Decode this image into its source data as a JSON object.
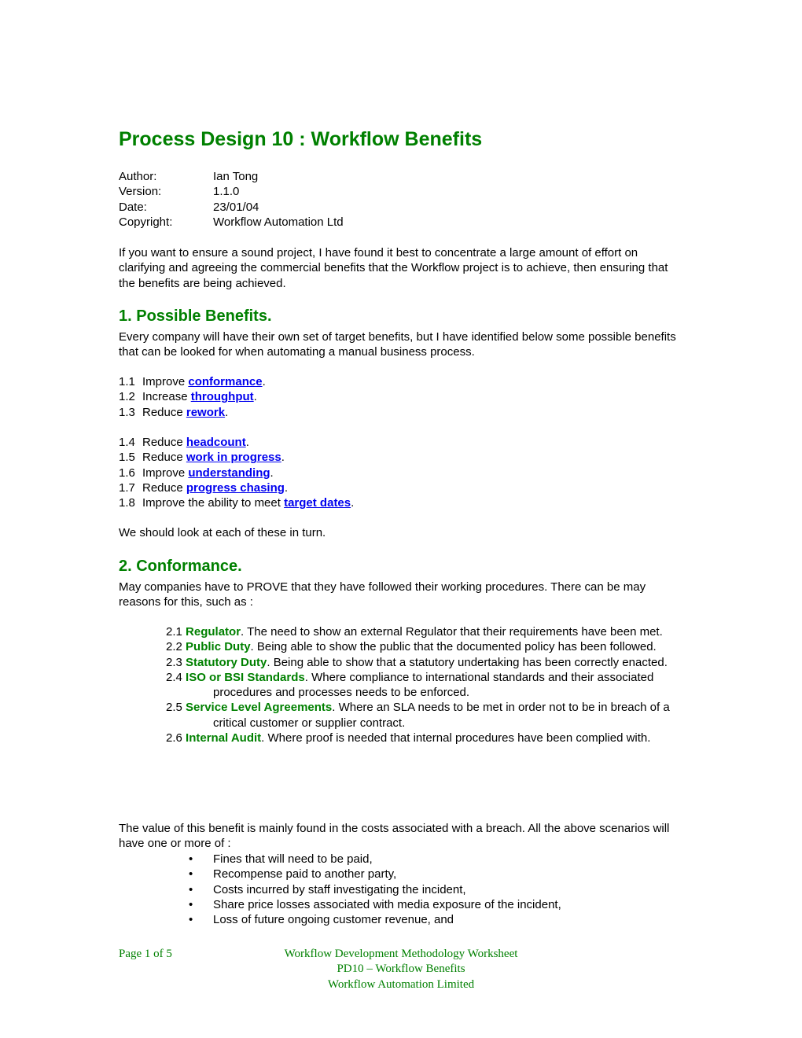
{
  "title": "Process Design 10 : Workflow Benefits",
  "meta": [
    {
      "label": "Author:",
      "value": "Ian Tong"
    },
    {
      "label": "Version:",
      "value": "1.1.0"
    },
    {
      "label": "Date:",
      "value": "23/01/04"
    },
    {
      "label": "Copyright:",
      "value": "Workflow Automation Ltd"
    }
  ],
  "intro": "If you want to ensure a sound project, I have found it best to concentrate a large amount of effort on clarifying and agreeing the commercial benefits that the Workflow project is to achieve, then ensuring that the benefits are being achieved.",
  "section1": {
    "heading": "1. Possible Benefits.",
    "text": "Every company will have their own set of target benefits, but I have identified below some possible benefits that can be looked for when automating a manual business process.",
    "benefits": [
      {
        "num": "1.1",
        "prefix": "Improve ",
        "link": "conformance",
        "suffix": "."
      },
      {
        "num": "1.2",
        "prefix": "Increase ",
        "link": "throughput",
        "suffix": "."
      },
      {
        "num": "1.3",
        "prefix": "Reduce ",
        "link": "rework",
        "suffix": "."
      },
      {
        "num": "1.4",
        "prefix": "Reduce ",
        "link": "headcount",
        "suffix": "."
      },
      {
        "num": "1.5",
        "prefix": "Reduce ",
        "link": "work in progress",
        "suffix": "."
      },
      {
        "num": "1.6",
        "prefix": "Improve ",
        "link": "understanding",
        "suffix": "."
      },
      {
        "num": "1.7",
        "prefix": "Reduce ",
        "link": "progress chasing",
        "suffix": "."
      },
      {
        "num": "1.8",
        "prefix": "Improve the ability to meet ",
        "link": "target dates",
        "suffix": "."
      }
    ],
    "closing": "We should look at each of these in turn."
  },
  "section2": {
    "heading": "2. Conformance.",
    "text": "May companies have to PROVE that they have followed their working procedures. There can be may reasons for this, such as :",
    "reasons": [
      {
        "num": "2.1 ",
        "term": "Regulator",
        "desc": ". The need to show an external Regulator that their requirements have been met."
      },
      {
        "num": "2.2 ",
        "term": "Public Duty",
        "desc": ". Being able to show the public that the documented policy has been followed."
      },
      {
        "num": "2.3 ",
        "term": "Statutory Duty",
        "desc": ". Being able to show that a statutory undertaking has been correctly enacted."
      },
      {
        "num": "2.4 ",
        "term": "ISO or BSI Standards",
        "desc": ". Where compliance to international standards and their associated procedures and processes needs to be enforced."
      },
      {
        "num": "2.5 ",
        "term": "Service Level Agreements",
        "desc": ". Where an SLA needs to be met in order not to be in breach of a critical customer or supplier contract."
      },
      {
        "num": "2.6 ",
        "term": "Internal Audit",
        "desc": ". Where proof is needed that internal procedures have been complied with."
      }
    ],
    "value_text": "The value of this benefit is mainly found in the costs associated with a breach. All the above scenarios will have one or more of :",
    "bullets": [
      "Fines that will need to be paid,",
      "Recompense paid to another party,",
      "Costs incurred by staff investigating the incident,",
      "Share price losses associated with media exposure of the incident,",
      "Loss of future ongoing customer revenue, and"
    ]
  },
  "footer": {
    "page": "Page 1 of 5",
    "line1": "Workflow Development Methodology Worksheet",
    "line2": "PD10 – Workflow Benefits",
    "line3": "Workflow Automation Limited"
  }
}
